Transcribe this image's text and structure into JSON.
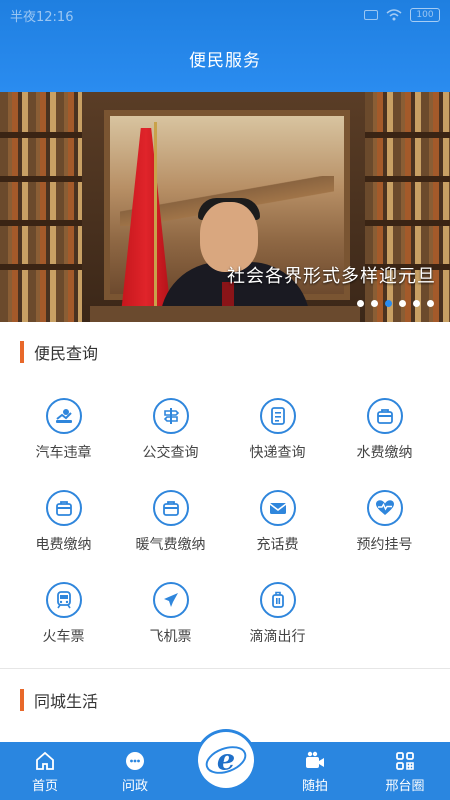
{
  "status_bar": {
    "time": "半夜12:16",
    "battery": "100"
  },
  "header": {
    "title": "便民服务"
  },
  "banner": {
    "caption": "社会各界形式多样迎元旦",
    "dot_count": 6,
    "active_dot": 3
  },
  "sections": {
    "query_title": "便民查询",
    "life_title": "同城生活"
  },
  "services": [
    {
      "label": "汽车违章",
      "icon": "car-violation-icon"
    },
    {
      "label": "公交查询",
      "icon": "bus-sign-icon"
    },
    {
      "label": "快递查询",
      "icon": "document-icon"
    },
    {
      "label": "水费缴纳",
      "icon": "bag-icon"
    },
    {
      "label": "电费缴纳",
      "icon": "bag-icon"
    },
    {
      "label": "暖气费缴纳",
      "icon": "bag-icon"
    },
    {
      "label": "充话费",
      "icon": "mail-icon"
    },
    {
      "label": "预约挂号",
      "icon": "heart-pulse-icon"
    },
    {
      "label": "火车票",
      "icon": "train-icon"
    },
    {
      "label": "飞机票",
      "icon": "plane-icon"
    },
    {
      "label": "滴滴出行",
      "icon": "luggage-icon"
    }
  ],
  "tabbar": {
    "items": [
      {
        "label": "首页",
        "icon": "home-icon"
      },
      {
        "label": "问政",
        "icon": "chat-icon"
      },
      {
        "label": "",
        "icon": "logo-e-icon"
      },
      {
        "label": "随拍",
        "icon": "video-camera-icon"
      },
      {
        "label": "邢台圈",
        "icon": "apps-icon"
      }
    ]
  },
  "colors": {
    "primary": "#2a86e0",
    "accent": "#e8682a",
    "icon_blue": "#2f86dc"
  }
}
